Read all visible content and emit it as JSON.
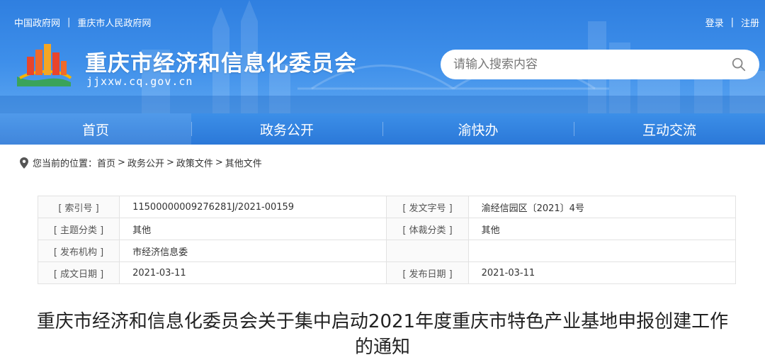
{
  "header": {
    "top_links": [
      "中国政府网",
      "重庆市人民政府网"
    ],
    "user_links": [
      "登录",
      "注册"
    ],
    "site_title": "重庆市经济和信息化委员会",
    "site_domain": "jjxxw.cq.gov.cn",
    "search_placeholder": "请输入搜索内容"
  },
  "nav": {
    "items": [
      {
        "label": "首页"
      },
      {
        "label": "政务公开"
      },
      {
        "label": "渝快办"
      },
      {
        "label": "互动交流"
      }
    ]
  },
  "breadcrumb": {
    "prefix": "您当前的位置：",
    "items": [
      "首页",
      "政务公开",
      "政策文件",
      "其他文件"
    ]
  },
  "info_table": {
    "rows": [
      {
        "label1": "[ 索引号 ]",
        "value1": "11500000009276281J/2021-00159",
        "label2": "[ 发文字号 ]",
        "value2": "渝经信园区〔2021〕4号"
      },
      {
        "label1": "[ 主题分类 ]",
        "value1": "其他",
        "label2": "[ 体裁分类 ]",
        "value2": "其他"
      },
      {
        "label1": "[ 发布机构 ]",
        "value1": "市经济信息委",
        "label2": "",
        "value2": ""
      },
      {
        "label1": "[ 成文日期 ]",
        "value1": "2021-03-11",
        "label2": "[ 发布日期 ]",
        "value2": "2021-03-11"
      }
    ]
  },
  "document": {
    "title": "重庆市经济和信息化委员会关于集中启动2021年度重庆市特色产业基地申报创建工作的通知"
  },
  "colors": {
    "header_blue": "#3e8fea",
    "nav_blue": "#2b78d8"
  }
}
